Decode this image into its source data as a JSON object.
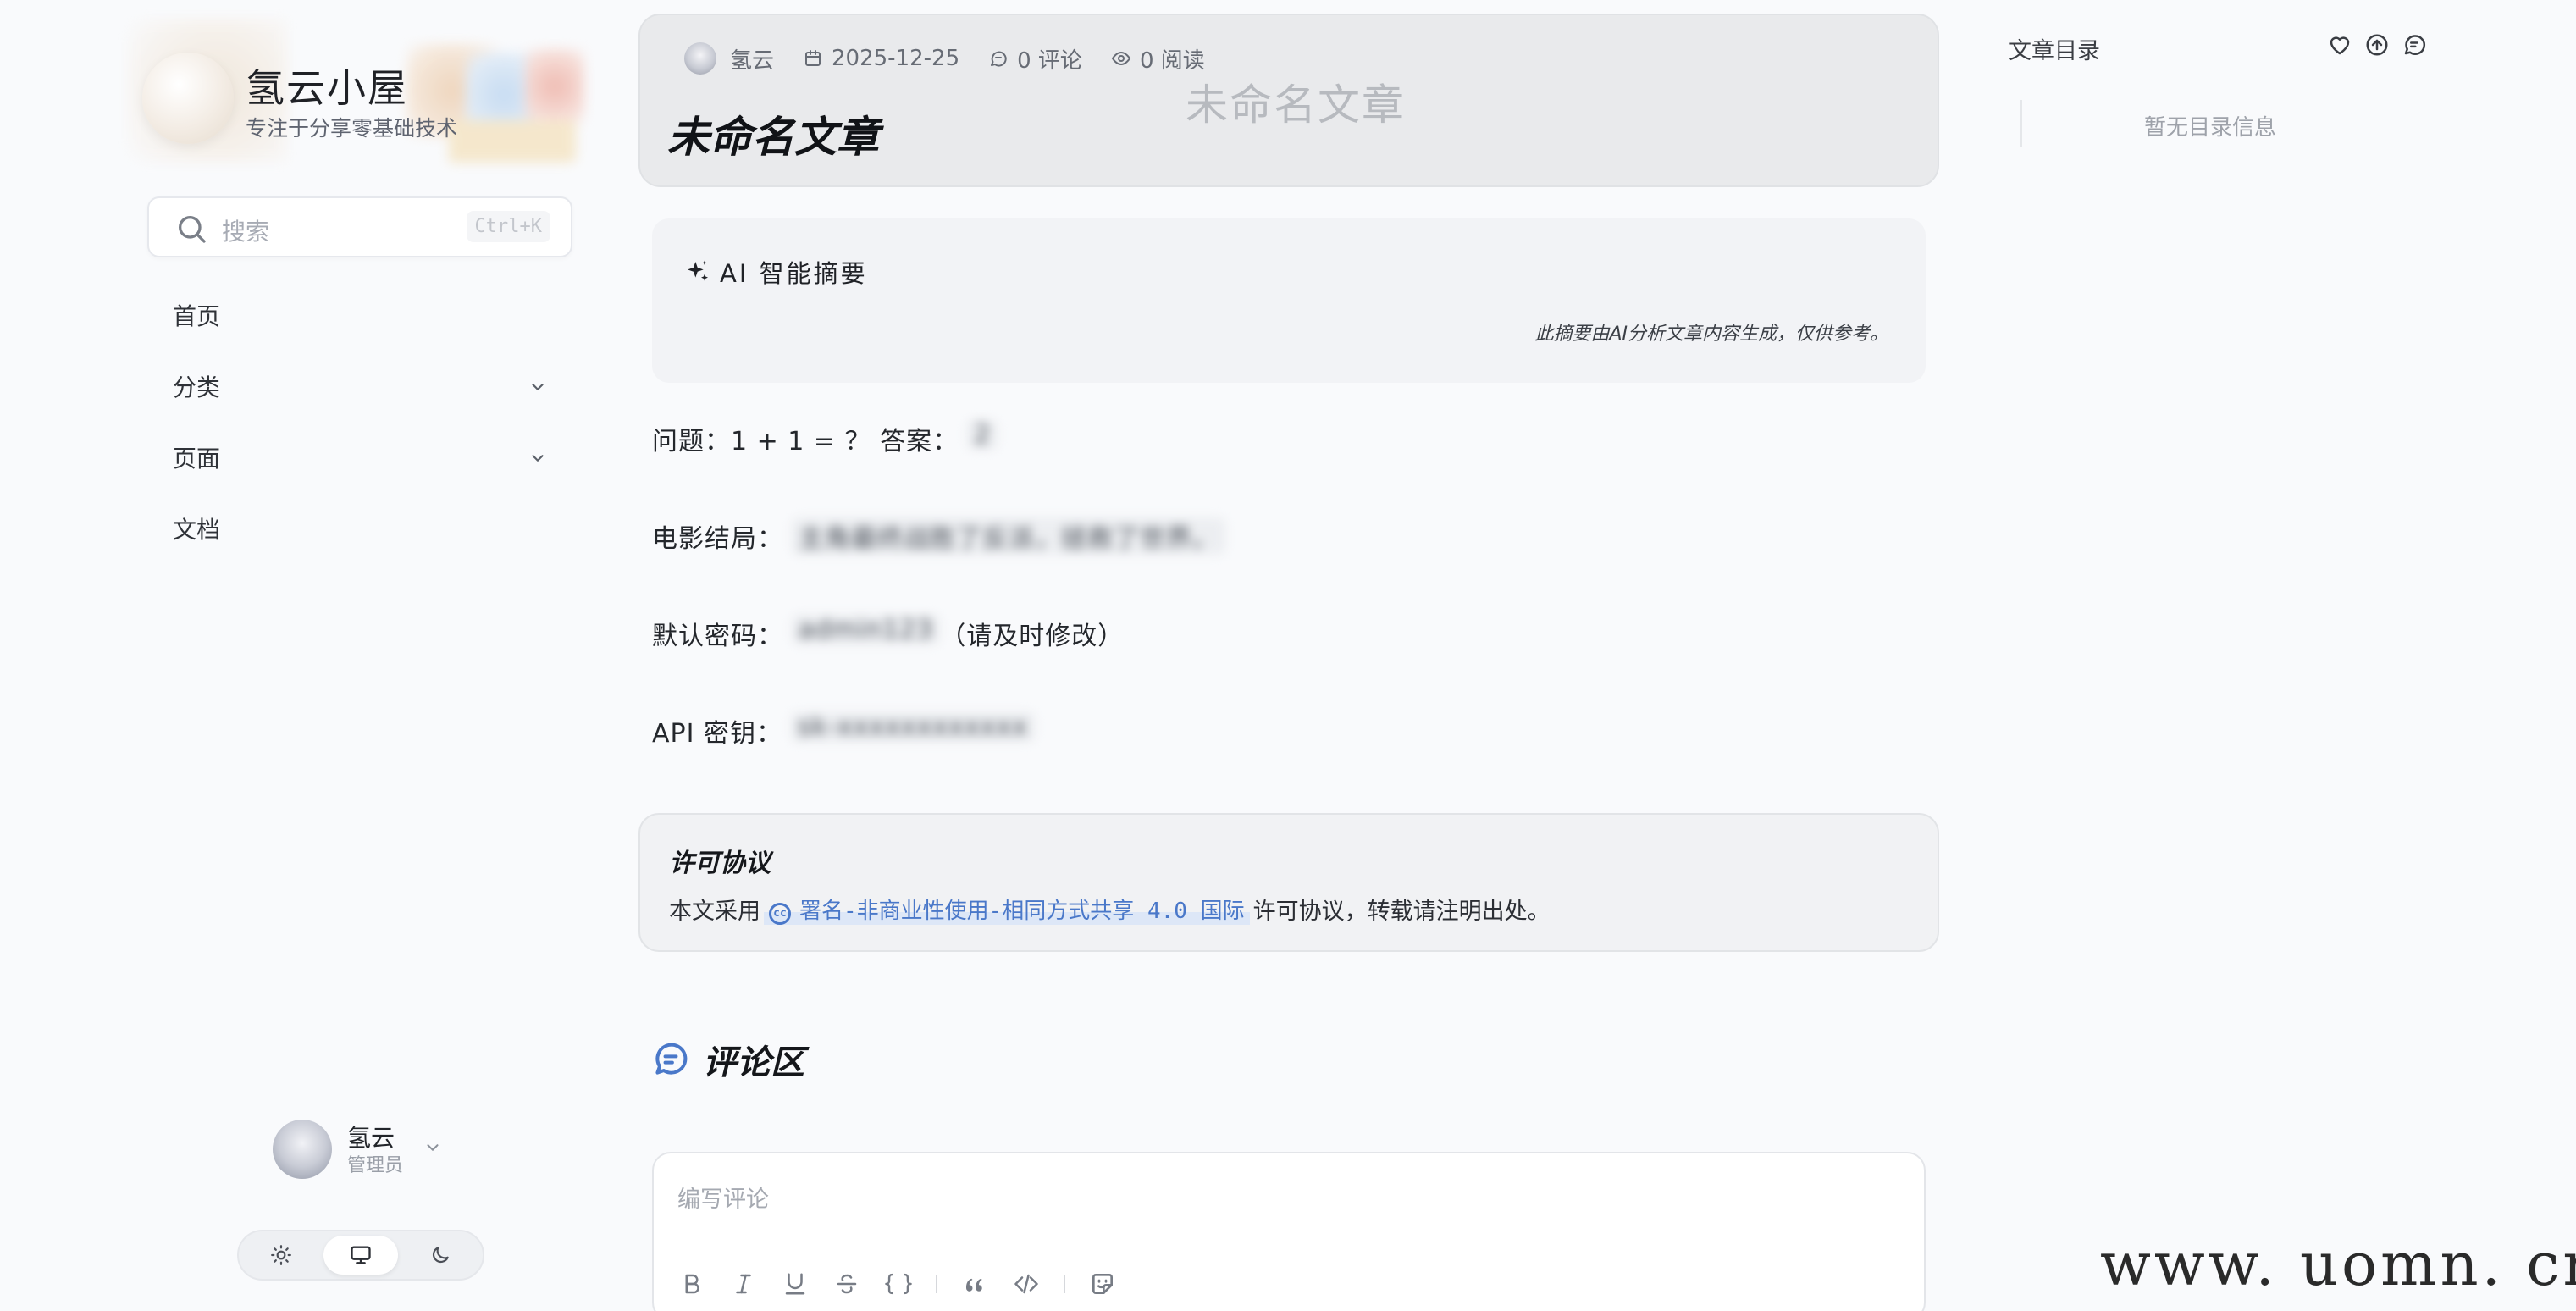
{
  "sidebar": {
    "brand": {
      "title": "氢云小屋",
      "subtitle": "专注于分享零基础技术"
    },
    "search": {
      "placeholder": "搜索",
      "shortcut": "Ctrl+K"
    },
    "nav": [
      {
        "label": "首页",
        "has_children": false
      },
      {
        "label": "分类",
        "has_children": true
      },
      {
        "label": "页面",
        "has_children": true
      },
      {
        "label": "文档",
        "has_children": false
      }
    ],
    "user": {
      "name": "氢云",
      "role": "管理员"
    },
    "theme": {
      "options": [
        "light-icon",
        "monitor-icon",
        "moon-icon"
      ],
      "active": "monitor-icon"
    }
  },
  "post": {
    "author": "氢云",
    "date": "2025-12-25",
    "comments": "0 评论",
    "views": "0 阅读",
    "title": "未命名文章",
    "title_watermark": "未命名文章"
  },
  "ai_summary": {
    "heading": "AI 智能摘要",
    "note": "此摘要由AI分析文章内容生成，仅供参考。"
  },
  "content": {
    "p1_label": "问题：1 + 1 = ？ 答案：",
    "p1_hidden": "2",
    "p2_label": "电影结局：",
    "p2_hidden": "主角最终战胜了反派，拯救了世界。",
    "p3_label": "默认密码：",
    "p3_hidden": "admin123",
    "p3_suffix": "（请及时修改）",
    "p4_label": "API 密钥：",
    "p4_hidden": "sk-xxxxxxxxxxxx"
  },
  "license": {
    "title": "许可协议",
    "prefix": "本文采用",
    "link": "署名-非商业性使用-相同方式共享 4.0 国际",
    "suffix": "许可协议，转载请注明出处。"
  },
  "comments": {
    "title": "评论区",
    "placeholder": "编写评论",
    "toolbar": [
      "bold-icon",
      "italic-icon",
      "underline-icon",
      "strikethrough-icon",
      "braces-icon",
      "quote-icon",
      "code-icon",
      "emoji-icon"
    ]
  },
  "toc": {
    "title": "文章目录",
    "empty": "暂无目录信息"
  },
  "site_watermark": "www. uomn. cn",
  "colors": {
    "accent": "#4a78c9",
    "background": "#f9fafc",
    "header_card": "#e9eaec"
  }
}
